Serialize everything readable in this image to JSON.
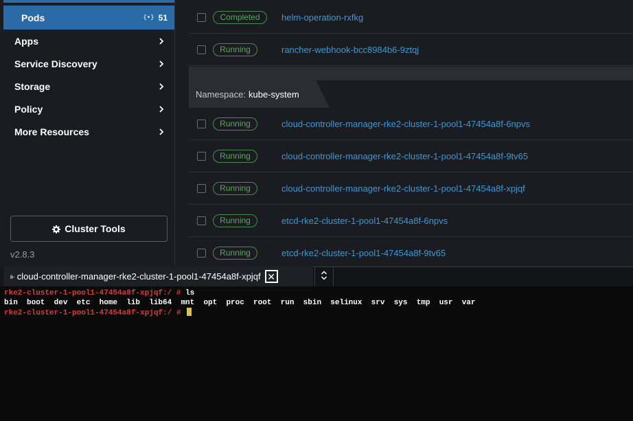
{
  "sidebar": {
    "active": {
      "label": "Pods",
      "badge_icon": "{•}",
      "count": "51"
    },
    "items": [
      {
        "label": "Apps"
      },
      {
        "label": "Service Discovery"
      },
      {
        "label": "Storage"
      },
      {
        "label": "Policy"
      },
      {
        "label": "More Resources"
      }
    ],
    "cluster_tools_label": "Cluster Tools",
    "version": "v2.8.3"
  },
  "pods": {
    "rows_top": [
      {
        "status": "Completed",
        "name": "helm-operation-rxfkg"
      },
      {
        "status": "Running",
        "name": "rancher-webhook-bcc8984b6-9ztqj"
      }
    ],
    "namespace": {
      "prefix": "Namespace:",
      "name": "kube-system"
    },
    "rows_ns": [
      {
        "status": "Running",
        "name": "cloud-controller-manager-rke2-cluster-1-pool1-47454a8f-6npvs"
      },
      {
        "status": "Running",
        "name": "cloud-controller-manager-rke2-cluster-1-pool1-47454a8f-9tv65"
      },
      {
        "status": "Running",
        "name": "cloud-controller-manager-rke2-cluster-1-pool1-47454a8f-xpjqf"
      },
      {
        "status": "Running",
        "name": "etcd-rke2-cluster-1-pool1-47454a8f-6npvs"
      },
      {
        "status": "Running",
        "name": "etcd-rke2-cluster-1-pool1-47454a8f-9tv65"
      }
    ]
  },
  "terminal": {
    "tab_icon": "⫦",
    "tab_title": "cloud-controller-manager-rke2-cluster-1-pool1-47454a8f-xpjqf",
    "close_glyph": "✕",
    "lines": [
      {
        "prompt": "rke2-cluster-1-pool1-47454a8f-xpjqf:/ # ",
        "cmd": "ls"
      },
      {
        "output": "bin  boot  dev  etc  home  lib  lib64  mnt  opt  proc  root  run  sbin  selinux  srv  sys  tmp  usr  var"
      },
      {
        "prompt": "rke2-cluster-1-pool1-47454a8f-xpjqf:/ # ",
        "cmd": ""
      }
    ]
  },
  "colors": {
    "accent": "#2a6aa6",
    "link": "#3d98d3",
    "status_green": "#5ba65b",
    "prompt_red": "#d73b3b"
  }
}
